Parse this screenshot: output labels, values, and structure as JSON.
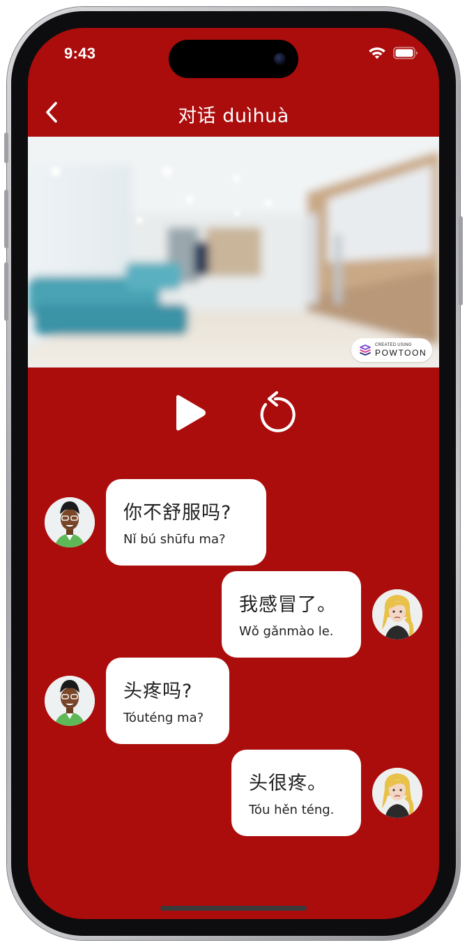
{
  "status_bar": {
    "time": "9:43"
  },
  "header": {
    "title": "对话 duìhuà",
    "back_icon": "chevron-left-icon"
  },
  "video": {
    "watermark_small": "CREATED USING",
    "watermark_brand": "POWTOON"
  },
  "controls": {
    "play_icon": "play-icon",
    "replay_icon": "replay-icon"
  },
  "colors": {
    "background": "#ab0c0c",
    "bubble": "#ffffff",
    "text": "#1e1e1e"
  },
  "dialogue": [
    {
      "speaker": "man",
      "side": "left",
      "hanzi": "你不舒服吗?",
      "pinyin": "Nǐ bú shūfu ma?"
    },
    {
      "speaker": "woman",
      "side": "right",
      "hanzi": "我感冒了。",
      "pinyin": "Wǒ gǎnmào le."
    },
    {
      "speaker": "man",
      "side": "left",
      "hanzi": "头疼吗?",
      "pinyin": "Tóuténg ma?"
    },
    {
      "speaker": "woman",
      "side": "right",
      "hanzi": "头很疼。",
      "pinyin": "Tóu hěn téng."
    }
  ]
}
